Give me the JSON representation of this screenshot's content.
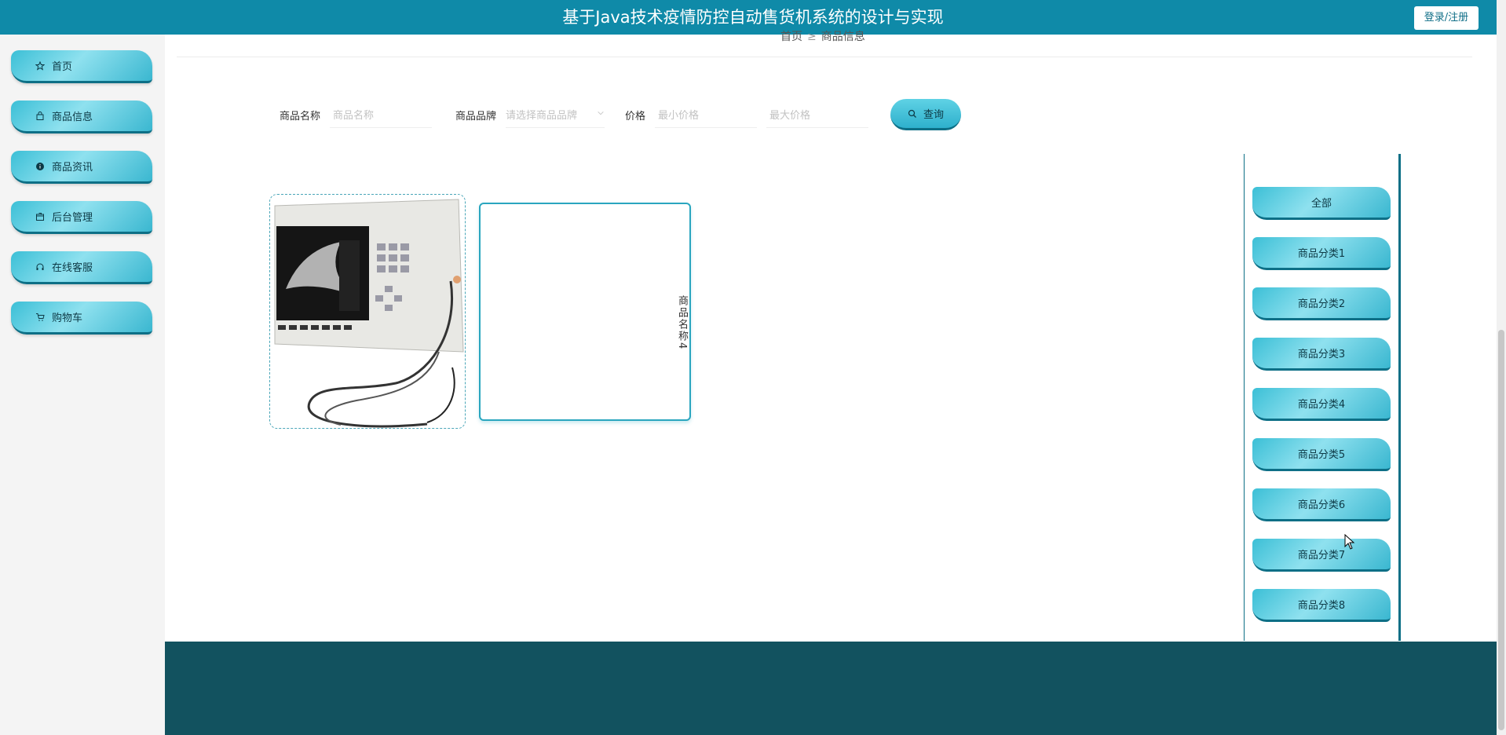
{
  "header": {
    "title": "基于Java技术疫情防控自动售货机系统的设计与实现",
    "login_label": "登录/注册"
  },
  "sidebar": {
    "items": [
      {
        "label": "首页",
        "icon": "star-icon"
      },
      {
        "label": "商品信息",
        "icon": "bag-icon"
      },
      {
        "label": "商品资讯",
        "icon": "info-icon"
      },
      {
        "label": "后台管理",
        "icon": "box-icon"
      },
      {
        "label": "在线客服",
        "icon": "headset-icon"
      },
      {
        "label": "购物车",
        "icon": "cart-icon"
      }
    ]
  },
  "breadcrumb": {
    "home": "首页",
    "separator": "≥",
    "current": "商品信息"
  },
  "search": {
    "name_label": "商品名称",
    "name_placeholder": "商品名称",
    "brand_label": "商品品牌",
    "brand_placeholder": "请选择商品品牌",
    "price_label": "价格",
    "min_price_placeholder": "最小价格",
    "max_price_placeholder": "最大价格",
    "button_label": "查询"
  },
  "products": [
    {
      "type": "image",
      "image": "ultrasound-machine"
    },
    {
      "type": "text",
      "name": "商品名称4"
    }
  ],
  "categories": [
    "全部",
    "商品分类1",
    "商品分类2",
    "商品分类3",
    "商品分类4",
    "商品分类5",
    "商品分类6",
    "商品分类7",
    "商品分类8"
  ],
  "colors": {
    "topbar": "#0f8aa8",
    "accent": "#3bbfd6",
    "footer": "#12525f"
  }
}
